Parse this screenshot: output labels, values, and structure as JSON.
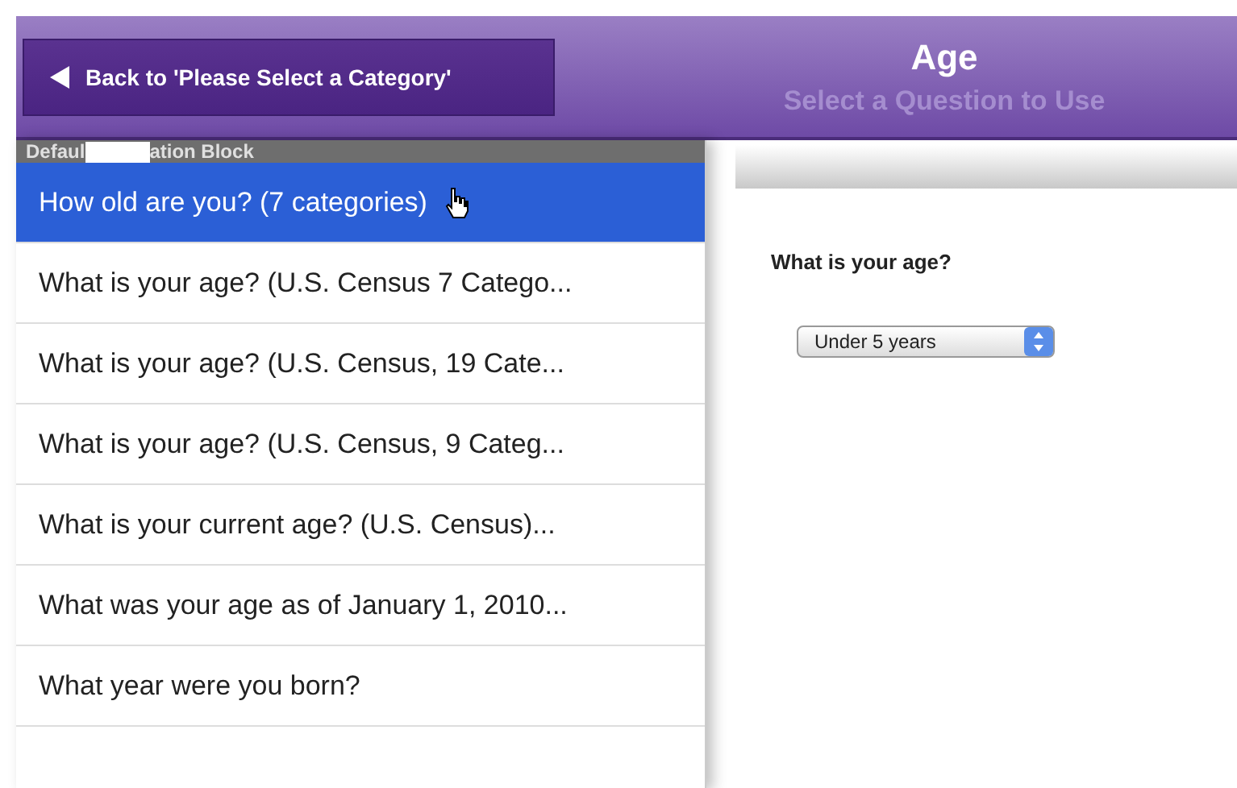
{
  "header": {
    "back_button": "Back to 'Please Select a Category'",
    "title": "Age",
    "subtitle": "Select a Question to Use"
  },
  "block_header": {
    "before_redaction": "Defaul",
    "after_redaction": "ation Block"
  },
  "questions": [
    {
      "label": "How old are you? (7 categories)",
      "selected": true
    },
    {
      "label": "What is your age? (U.S. Census 7 Catego...",
      "selected": false
    },
    {
      "label": "What is your age? (U.S. Census, 19 Cate...",
      "selected": false
    },
    {
      "label": "What is your age? (U.S. Census, 9 Categ...",
      "selected": false
    },
    {
      "label": "What is your current age? (U.S. Census)...",
      "selected": false
    },
    {
      "label": "What was your age as of January 1, 2010...",
      "selected": false
    },
    {
      "label": "What year were you born?",
      "selected": false
    }
  ],
  "preview": {
    "question": "What is your age?",
    "dropdown_value": "Under 5 years"
  }
}
